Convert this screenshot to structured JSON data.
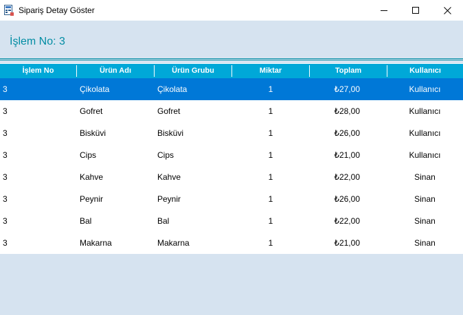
{
  "window": {
    "title": "Sipariş Detay Göster",
    "icon": "form-icon"
  },
  "header": {
    "islem_label": "İşlem No: 3"
  },
  "grid": {
    "columns": [
      "İşlem No",
      "Ürün Adı",
      "Ürün Grubu",
      "Miktar",
      "Toplam",
      "Kullanıcı"
    ],
    "selected_row": 0,
    "rows": [
      {
        "islem": "3",
        "urun_adi": "Çikolata",
        "urun_grubu": "Çikolata",
        "miktar": "1",
        "toplam": "₺27,00",
        "kullanici": "Kullanıcı"
      },
      {
        "islem": "3",
        "urun_adi": "Gofret",
        "urun_grubu": "Gofret",
        "miktar": "1",
        "toplam": "₺28,00",
        "kullanici": "Kullanıcı"
      },
      {
        "islem": "3",
        "urun_adi": "Bisküvi",
        "urun_grubu": "Bisküvi",
        "miktar": "1",
        "toplam": "₺26,00",
        "kullanici": "Kullanıcı"
      },
      {
        "islem": "3",
        "urun_adi": "Cips",
        "urun_grubu": "Cips",
        "miktar": "1",
        "toplam": "₺21,00",
        "kullanici": "Kullanıcı"
      },
      {
        "islem": "3",
        "urun_adi": "Kahve",
        "urun_grubu": "Kahve",
        "miktar": "1",
        "toplam": "₺22,00",
        "kullanici": "Sinan"
      },
      {
        "islem": "3",
        "urun_adi": "Peynir",
        "urun_grubu": "Peynir",
        "miktar": "1",
        "toplam": "₺26,00",
        "kullanici": "Sinan"
      },
      {
        "islem": "3",
        "urun_adi": "Bal",
        "urun_grubu": "Bal",
        "miktar": "1",
        "toplam": "₺22,00",
        "kullanici": "Sinan"
      },
      {
        "islem": "3",
        "urun_adi": "Makarna",
        "urun_grubu": "Makarna",
        "miktar": "1",
        "toplam": "₺21,00",
        "kullanici": "Sinan"
      }
    ]
  },
  "colors": {
    "header_bg": "#00a8d8",
    "selection": "#0078d7",
    "form_bg": "#d6e3f0",
    "accent_text": "#008ca3"
  }
}
